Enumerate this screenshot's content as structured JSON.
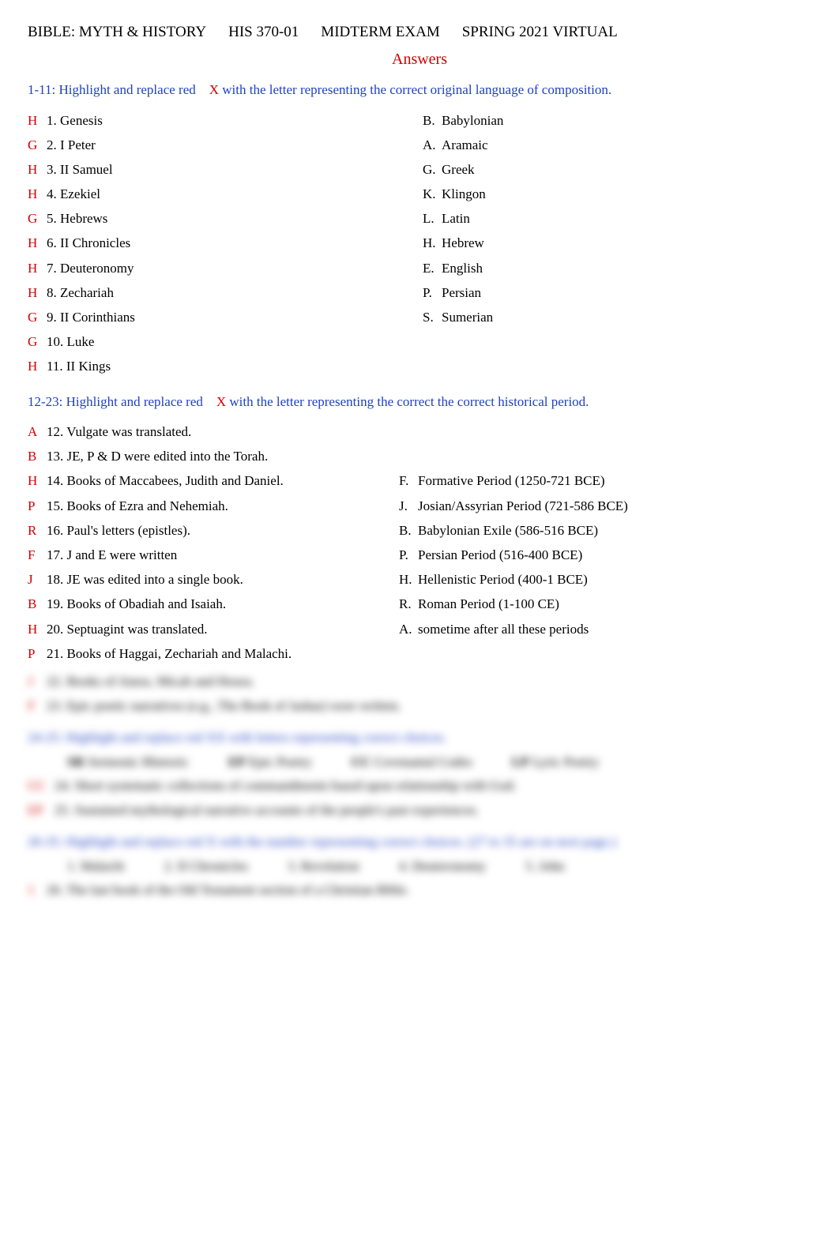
{
  "header": {
    "course_title": "BIBLE: MYTH & HISTORY",
    "course_code": "HIS 370-01",
    "exam": "MIDTERM EXAM",
    "term": "SPRING 2021 VIRTUAL"
  },
  "answers_label": "Answers",
  "section1": {
    "instruction_pre": "1-11:  Highlight and replace red",
    "instruction_x": "X",
    "instruction_post": "with the letter representing the correct original language of composition.",
    "questions": [
      {
        "ans": "H",
        "text": "1. Genesis"
      },
      {
        "ans": "G",
        "text": "2. I Peter"
      },
      {
        "ans": "H",
        "text": "3. II Samuel"
      },
      {
        "ans": "H",
        "text": "4. Ezekiel"
      },
      {
        "ans": "G",
        "text": "5. Hebrews"
      },
      {
        "ans": "H",
        "text": "6. II Chronicles"
      },
      {
        "ans": "H",
        "text": "7.  Deuteronomy"
      },
      {
        "ans": "H",
        "text": "8. Zechariah"
      },
      {
        "ans": "G",
        "text": "9. II Corinthians"
      },
      {
        "ans": "G",
        "text": "10. Luke"
      },
      {
        "ans": "H",
        "text": "11. II Kings"
      }
    ],
    "options": [
      {
        "letter": "B.",
        "text": "Babylonian"
      },
      {
        "letter": "A.",
        "text": "Aramaic"
      },
      {
        "letter": "G.",
        "text": "Greek"
      },
      {
        "letter": "K.",
        "text": "Klingon"
      },
      {
        "letter": "L.",
        "text": "Latin"
      },
      {
        "letter": "H.",
        "text": "Hebrew"
      },
      {
        "letter": "E.",
        "text": "English"
      },
      {
        "letter": "P.",
        "text": "Persian"
      },
      {
        "letter": "S.",
        "text": "Sumerian"
      }
    ]
  },
  "section2": {
    "instruction_pre": "12-23:  Highlight and replace red",
    "instruction_x": "X",
    "instruction_post": "with the letter representing the correct the correct historical period.",
    "questions": [
      {
        "ans": "A",
        "text": "12. Vulgate was translated."
      },
      {
        "ans": "B",
        "text": "13. JE, P & D were edited into the Torah."
      },
      {
        "ans": "H",
        "text": "14. Books of Maccabees, Judith and Daniel."
      },
      {
        "ans": "P",
        "text": "15. Books of Ezra and Nehemiah."
      },
      {
        "ans": "R",
        "text": "16. Paul's letters (epistles)."
      },
      {
        "ans": "F",
        "text": "17. J and E were written"
      },
      {
        "ans": "J",
        "text": "18. JE was edited into a single book."
      },
      {
        "ans": "B",
        "text": "19. Books of Obadiah and Isaiah."
      },
      {
        "ans": "H",
        "text": "20. Septuagint was translated."
      },
      {
        "ans": "P",
        "text": "21. Books of Haggai, Zechariah and Malachi."
      }
    ],
    "options": [
      {
        "letter": "F.",
        "text": "Formative Period (1250-721 BCE)"
      },
      {
        "letter": "J.",
        "text": "Josian/Assyrian Period (721-586 BCE)"
      },
      {
        "letter": "B.",
        "text": "Babylonian Exile (586-516 BCE)"
      },
      {
        "letter": "P.",
        "text": "Persian Period (516-400 BCE)"
      },
      {
        "letter": "H.",
        "text": "Hellenistic Period (400-1 BCE)"
      },
      {
        "letter": "R.",
        "text": "Roman Period (1-100 CE)"
      },
      {
        "letter": "A.",
        "text": "sometime  after  all these periods"
      }
    ]
  },
  "blurred": {
    "q22": {
      "ans": "J",
      "text": "22. Books of Amos, Micah and Hosea."
    },
    "q23": {
      "ans": "F",
      "text": "23. Epic poetic narratives (e.g., The Book of Jashar) were written."
    },
    "section3_instruction": "24-25:  Highlight and replace red XX with letters representing correct choices.",
    "s3_options": [
      {
        "letter": "SR",
        "text": "Sermonic Rhetoric"
      },
      {
        "letter": "EP",
        "text": "Epic Poetry"
      },
      {
        "letter": "CC",
        "text": "Covenantal Codes"
      },
      {
        "letter": "LP",
        "text": "Lyric Poetry"
      }
    ],
    "q24": {
      "ans": "CC",
      "text": "24. Short systematic collections of commandments based upon relationship with God."
    },
    "q25": {
      "ans": "EP",
      "text": "25. Sustained mythological narrative accounts of the people's past experiences."
    },
    "section4_instruction": "26-35:  Highlight and replace red X with the number representing correct choices. (27 to 35 are on next page.)",
    "s4_options": [
      {
        "text": "1. Malachi"
      },
      {
        "text": "2. II Chronicles"
      },
      {
        "text": "3. Revelation"
      },
      {
        "text": "4. Deuteronomy"
      },
      {
        "text": "5. John"
      }
    ],
    "q26": {
      "ans": "1",
      "text": "26. The last book of the Old Testament section of a Christian Bible."
    }
  }
}
